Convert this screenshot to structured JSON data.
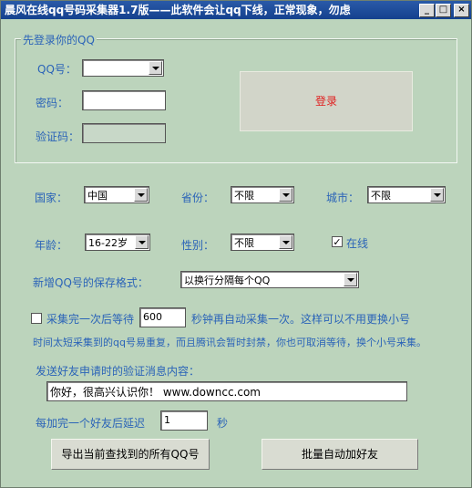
{
  "window": {
    "title": "晨风在线qq号码采集器1.7版——此软件会让qq下线，正常现象，勿虑",
    "min_glyph": "_",
    "max_glyph": "□",
    "close_glyph": "×"
  },
  "login": {
    "group_title": "先登录你的QQ",
    "qq_label": "QQ号：",
    "qq_value": "",
    "password_label": "密码：",
    "password_value": "",
    "captcha_label": "验证码：",
    "captcha_value": "",
    "login_button": "登录"
  },
  "filters": {
    "country_label": "国家：",
    "country_value": "中国",
    "province_label": "省份：",
    "province_value": "不限",
    "city_label": "城市：",
    "city_value": "不限",
    "age_label": "年龄：",
    "age_value": "16-22岁",
    "gender_label": "性别：",
    "gender_value": "不限",
    "online_label": "在线",
    "online_checked": true,
    "online_check_glyph": "✓"
  },
  "save_format": {
    "label": "新增QQ号的保存格式：",
    "value": "以换行分隔每个QQ"
  },
  "auto_collect": {
    "checked": false,
    "label_before": "采集完一次后等待",
    "seconds_value": "600",
    "label_after": "秒钟再自动采集一次。这样可以不用更换小号",
    "note": "时间太短采集到的qq号易重复，而且腾讯会暂时封禁，你也可取消等待，换个小号采集。"
  },
  "friend_request": {
    "label": "发送好友申请时的验证消息内容：",
    "message_value": "你好，很高兴认识你！ www.downcc.com",
    "delay_label": "每加完一个好友后延迟",
    "delay_value": "1",
    "delay_unit": "秒"
  },
  "buttons": {
    "export": "导出当前查找到的所有QQ号",
    "auto_add": "批量自动加好友"
  }
}
